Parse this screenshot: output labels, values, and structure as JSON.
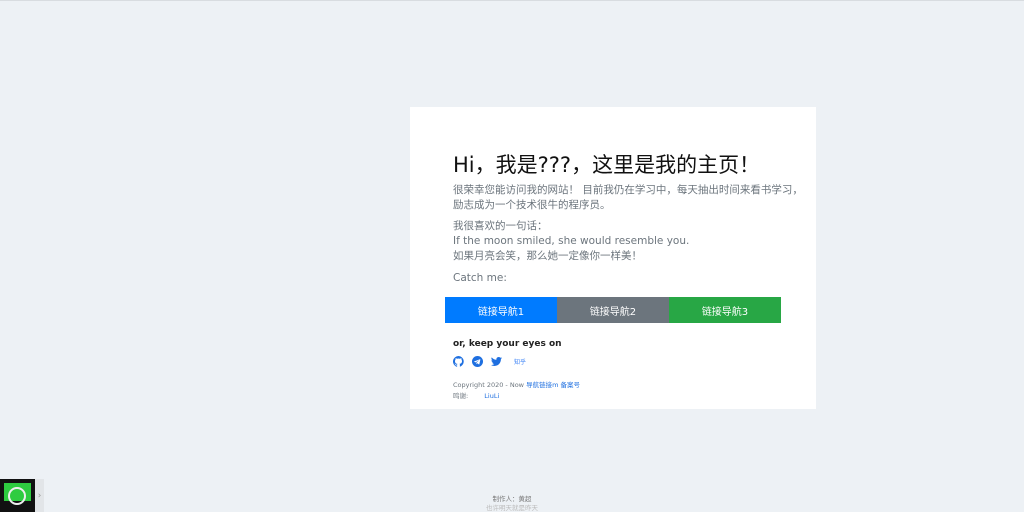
{
  "card": {
    "title": "Hi，我是???，这里是我的主页！",
    "intro_1": "很荣幸您能访问我的网站！ 目前我仍在学习中，每天抽出时间来看书学习，",
    "intro_2": "励志成为一个技术很牛的程序员。",
    "quote_label": "我很喜欢的一句话：",
    "quote_en": "If the moon smiled, she would resemble you.",
    "quote_zh": "如果月亮会笑，那么她一定像你一样美！",
    "catch": "Catch me:",
    "buttons": [
      {
        "label": "链接导航1",
        "color": "#007bff"
      },
      {
        "label": "链接导航2",
        "color": "#6c757d"
      },
      {
        "label": "链接导航3",
        "color": "#28a745"
      }
    ],
    "eyes": "or, keep your eyes on",
    "social": [
      "github-icon",
      "telegram-icon",
      "twitter-icon"
    ],
    "zhihu": "知乎",
    "copyright": "Copyright 2020 - Now",
    "nav_link": "导航链接m",
    "beian": "备案号",
    "thanks_label": "鸣谢:",
    "thanks_link": "LiuLi"
  },
  "footer": {
    "author": "制作人：黄超",
    "motto": "也许明天就是昨天"
  }
}
